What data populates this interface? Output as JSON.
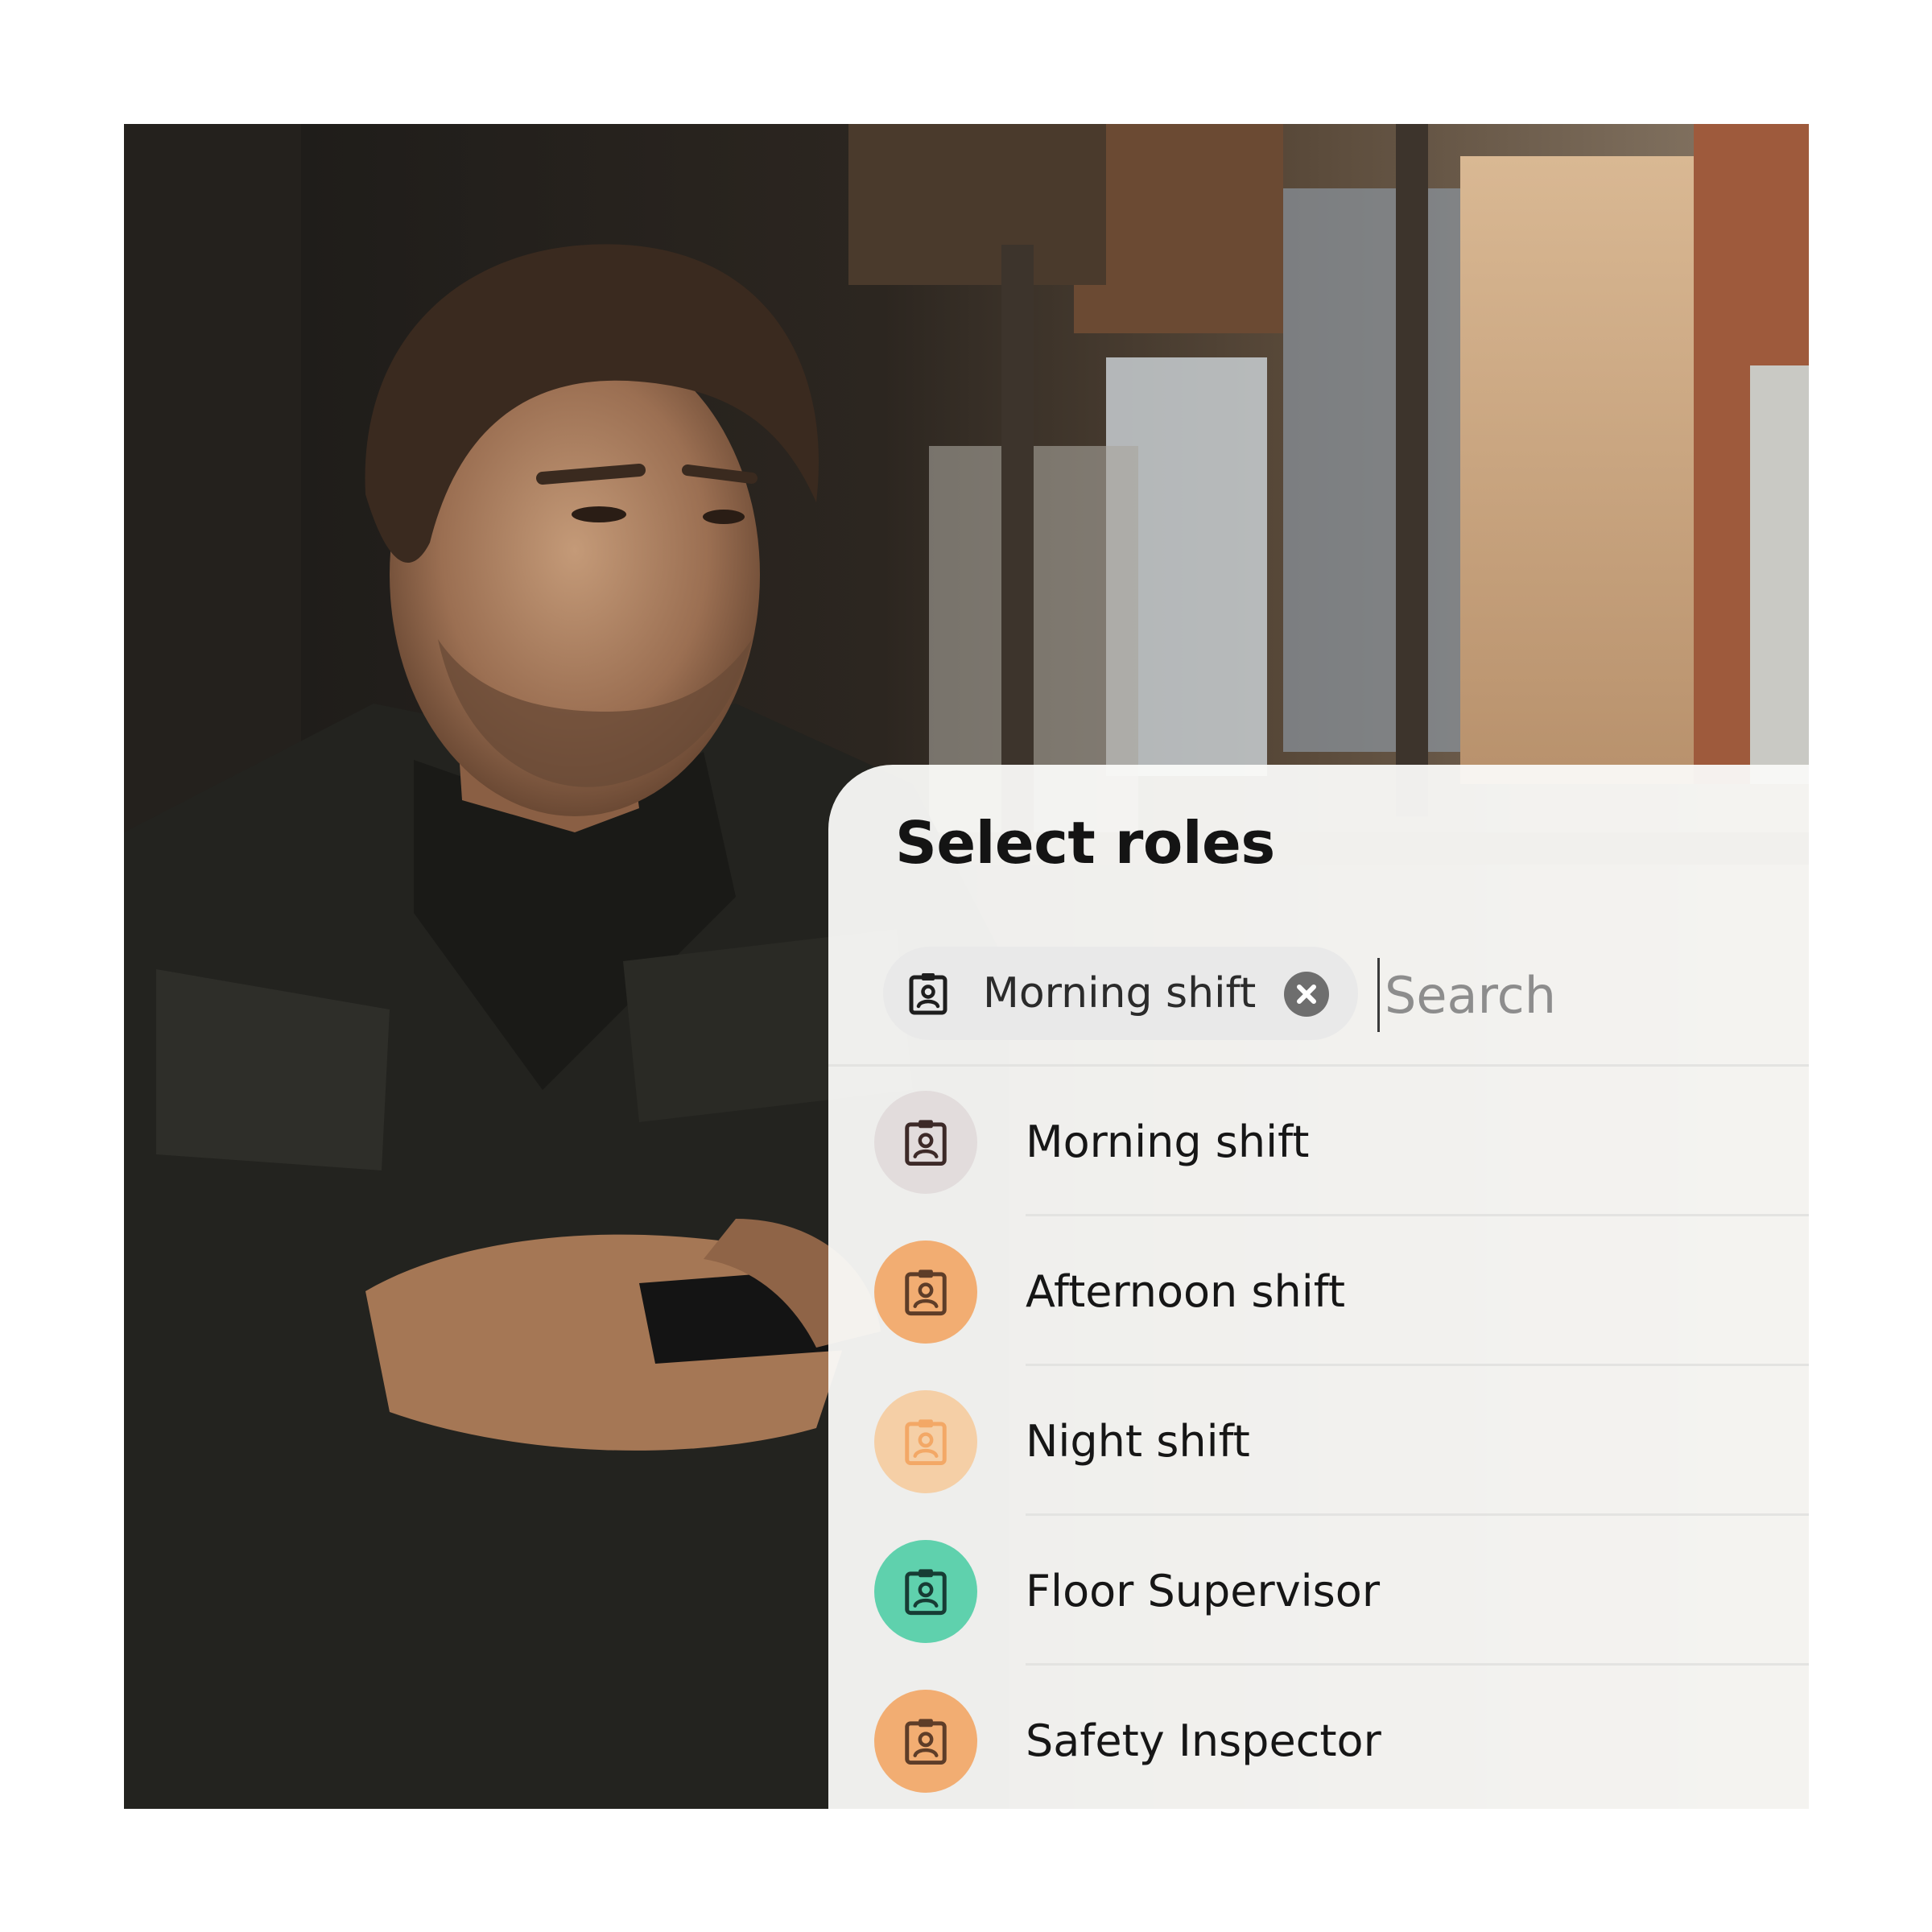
{
  "photo": {
    "description_icon": "person-photo"
  },
  "picker": {
    "title": "Select roles",
    "selected_chip": {
      "label": "Morning shift",
      "icon": "badge-icon",
      "remove_icon": "close-circle-icon"
    },
    "search": {
      "value": "",
      "placeholder": "Search"
    },
    "roles": [
      {
        "label": "Morning shift",
        "icon": "badge-icon",
        "color": "#e2dcdc",
        "icon_color": "#3d2a28"
      },
      {
        "label": "Afternoon shift",
        "icon": "badge-icon",
        "color": "#f2ad72",
        "icon_color": "#5e3d28"
      },
      {
        "label": "Night shift",
        "icon": "badge-icon",
        "color": "#f5cfa6",
        "icon_color": "#f3a866"
      },
      {
        "label": "Floor Supervisor",
        "icon": "badge-icon",
        "color": "#5fd1ad",
        "icon_color": "#173c34"
      },
      {
        "label": "Safety Inspector",
        "icon": "badge-icon",
        "color": "#f2ad72",
        "icon_color": "#5e3d28"
      }
    ]
  }
}
